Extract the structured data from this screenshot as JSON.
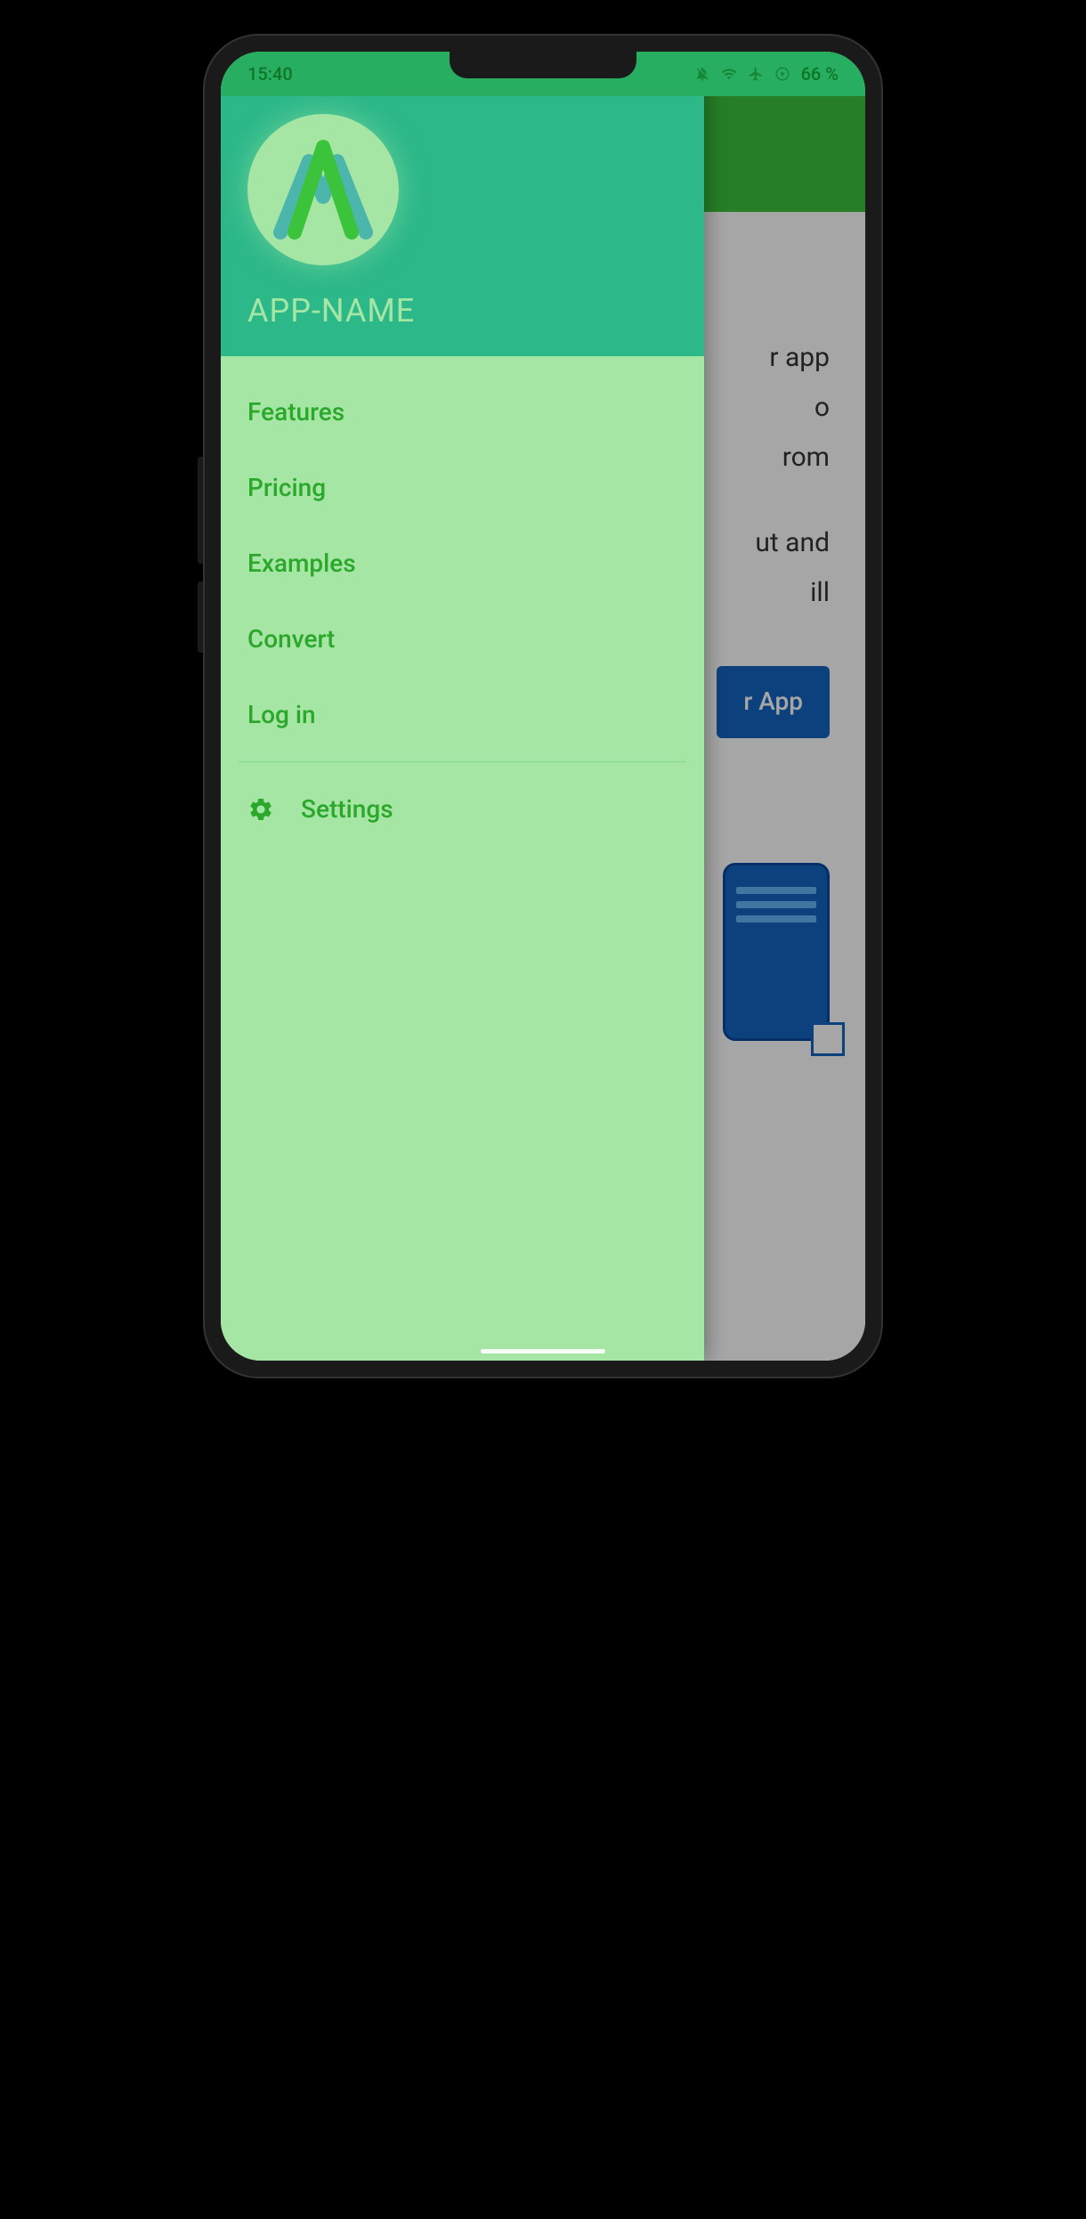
{
  "status_bar": {
    "time": "15:40",
    "battery": "66 %"
  },
  "drawer": {
    "app_name": "APP-NAME",
    "nav_items": [
      {
        "label": "Features"
      },
      {
        "label": "Pricing"
      },
      {
        "label": "Examples"
      },
      {
        "label": "Convert"
      },
      {
        "label": "Log in"
      }
    ],
    "settings_label": "Settings"
  },
  "background": {
    "text_fragments": {
      "line1": "r app",
      "line2": "o",
      "line3": "rom",
      "line4": "ut and",
      "line5": "ill"
    },
    "button_fragment": "r App"
  }
}
